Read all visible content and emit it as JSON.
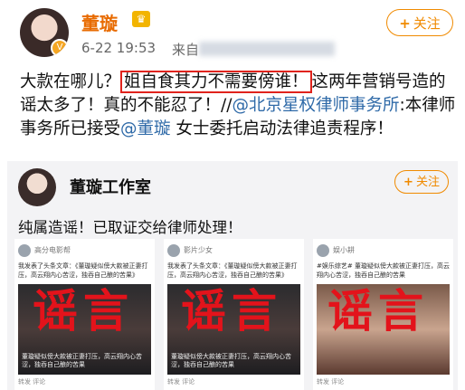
{
  "post": {
    "author": "董璇",
    "timestamp": "6-22 19:53",
    "source_label": "来自",
    "follow_plus": "+",
    "follow_label": "关注",
    "text_before": "大款在哪儿？",
    "text_boxed": "姐自食其力不需要傍谁！",
    "text_middle": "这两年营销号造的谣太多了！真的不能忍了！//",
    "mention_firm": "@北京星权律师事务所",
    "text_after_firm": ":本律师事务所已接受",
    "mention_person": "@董璇",
    "text_end": " 女士委托启动法律追责程序！"
  },
  "repost": {
    "author": "董璇工作室",
    "follow_plus": "+",
    "follow_label": "关注",
    "text": "纯属造谣！已取证交给律师处理！",
    "stamp": "谣言",
    "cards": [
      {
        "name": "高分电影帮",
        "body": "我发表了头条文章：《董璇疑似傍大款被正妻打压，高云翔内心苦涩，独吞自己酿的苦果》",
        "caption": "董璇疑似傍大款被正妻打压，高云翔内心苦涩，独吞自己酿的苦果",
        "footer": "转发  评论"
      },
      {
        "name": "影片少女",
        "body": "我发表了头条文章：《董璇疑似傍大款被正妻打压，高云翔内心苦涩，独吞自己酿的苦果》",
        "caption": "董璇疑似傍大款被正妻打压，高云翔内心苦涩，独吞自己酿的苦果",
        "footer": "转发  评论"
      },
      {
        "name": "娱小耕",
        "body": "#娱乐综艺# 董璇疑似傍大款被正妻打压，高云翔内心苦涩，独吞自己酿的苦果",
        "caption": "",
        "footer": "转发  评论"
      }
    ]
  }
}
